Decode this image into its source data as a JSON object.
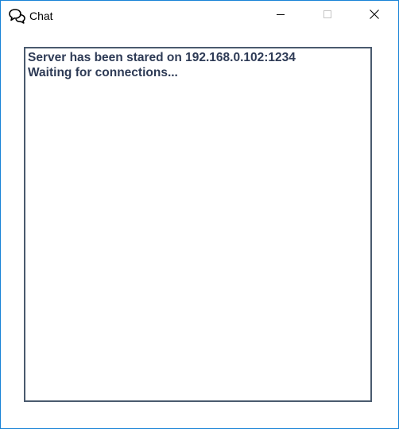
{
  "window": {
    "title": "Chat",
    "app_icon": "chat-bubbles-icon",
    "controls": {
      "minimize_icon": "minimize-icon",
      "maximize_icon": "maximize-icon",
      "close_icon": "close-icon"
    }
  },
  "log": {
    "lines": [
      "Server has been stared on 192.168.0.102:1234",
      "Waiting for connections..."
    ]
  },
  "colors": {
    "window_border": "#1883d7",
    "log_text": "#2e3b56",
    "log_border": "#4a5a6e"
  }
}
